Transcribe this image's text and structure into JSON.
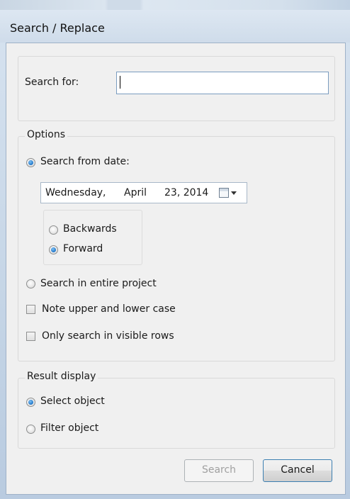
{
  "window": {
    "title": "Search / Replace"
  },
  "search": {
    "label": "Search for:",
    "value": ""
  },
  "options": {
    "legend": "Options",
    "search_from_date_label": "Search from date:",
    "search_from_date_checked": true,
    "date": {
      "weekday": "Wednesday,",
      "month": "April",
      "day_year": "23, 2014"
    },
    "direction": {
      "backwards_label": "Backwards",
      "backwards_checked": false,
      "forward_label": "Forward",
      "forward_checked": true
    },
    "entire_project_label": "Search in entire project",
    "entire_project_checked": false,
    "match_case_label": "Note upper and lower case",
    "match_case_checked": false,
    "visible_rows_label": "Only search in visible rows",
    "visible_rows_checked": false
  },
  "result_display": {
    "legend": "Result display",
    "select_object_label": "Select object",
    "select_object_checked": true,
    "filter_object_label": "Filter object",
    "filter_object_checked": false
  },
  "buttons": {
    "search_label": "Search",
    "search_enabled": false,
    "cancel_label": "Cancel"
  },
  "icons": {
    "calendar": "calendar-icon",
    "dropdown": "chevron-down-icon"
  }
}
